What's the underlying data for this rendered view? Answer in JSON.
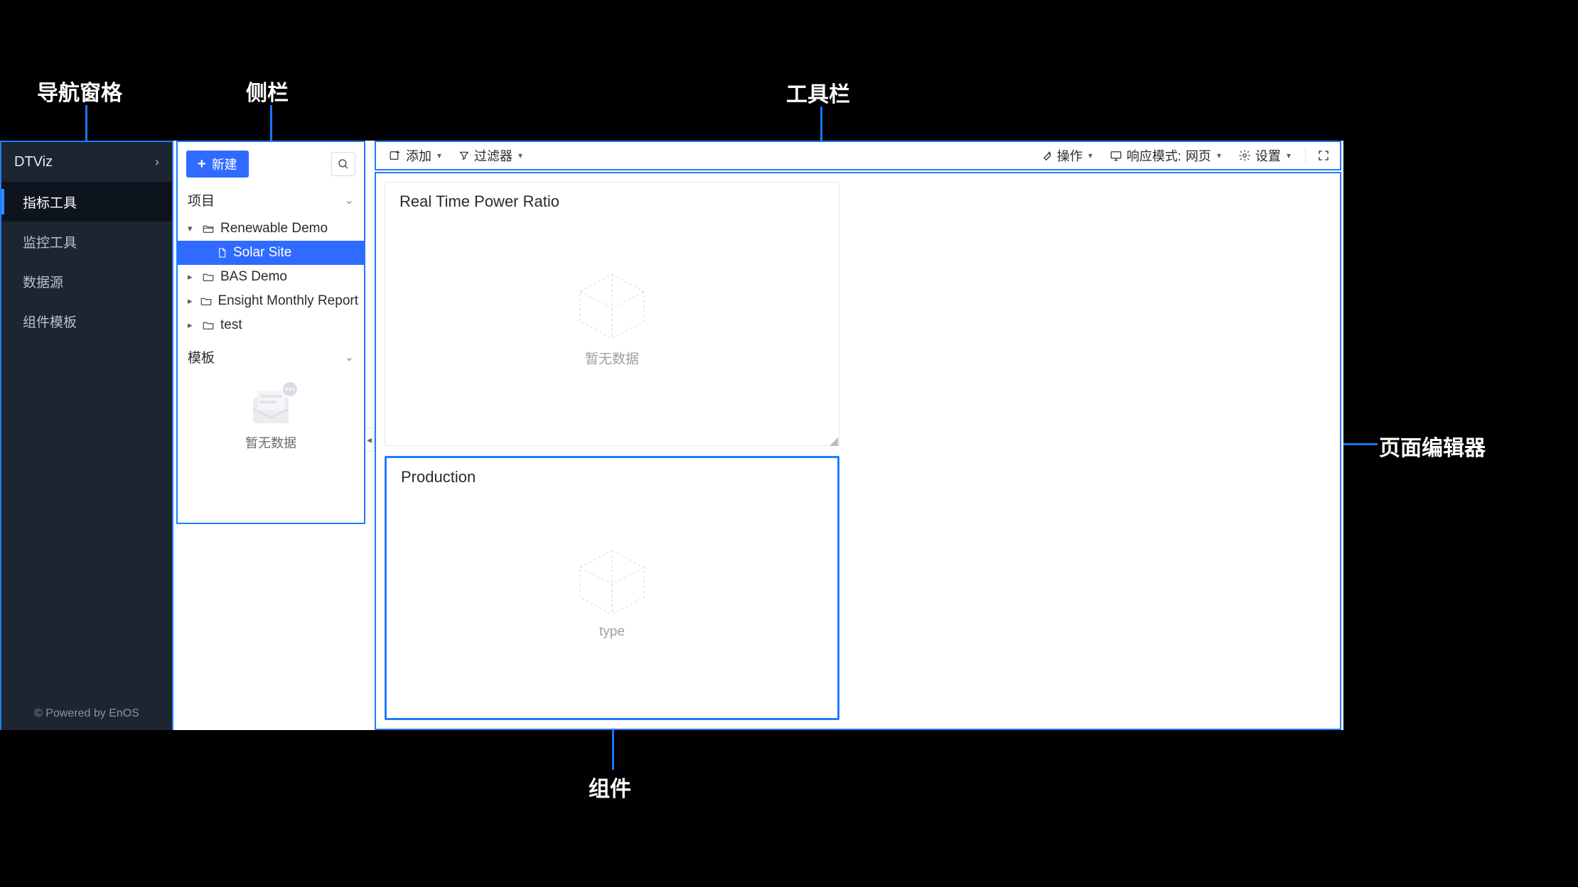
{
  "annotations": {
    "nav": "导航窗格",
    "sidebar": "侧栏",
    "toolbar": "工具栏",
    "editor": "页面编辑器",
    "widget": "组件"
  },
  "nav": {
    "title": "DTViz",
    "items": [
      {
        "label": "指标工具",
        "active": true
      },
      {
        "label": "监控工具",
        "active": false
      },
      {
        "label": "数据源",
        "active": false
      },
      {
        "label": "组件模板",
        "active": false
      }
    ],
    "footer": "© Powered by EnOS"
  },
  "sidebar": {
    "new_label": "新建",
    "sections": {
      "project": "项目",
      "template": "模板"
    },
    "tree": [
      {
        "label": "Renewable Demo",
        "type": "folder",
        "expanded": true
      },
      {
        "label": "Solar Site",
        "type": "file",
        "selected": true,
        "indent": 1
      },
      {
        "label": "BAS Demo",
        "type": "folder",
        "expanded": false
      },
      {
        "label": "Ensight Monthly Report",
        "type": "folder",
        "expanded": false
      },
      {
        "label": "test",
        "type": "folder",
        "expanded": false
      }
    ],
    "template_empty_text": "暂无数据"
  },
  "toolbar": {
    "add": "添加",
    "filter": "过滤器",
    "action": "操作",
    "responsive_prefix": "响应模式:",
    "responsive_value": "网页",
    "settings": "设置"
  },
  "editor": {
    "widgets": [
      {
        "title": "Real Time Power Ratio",
        "empty_text": "暂无数据",
        "selected": false
      },
      {
        "title": "Production",
        "empty_text": "type",
        "selected": true
      }
    ]
  }
}
